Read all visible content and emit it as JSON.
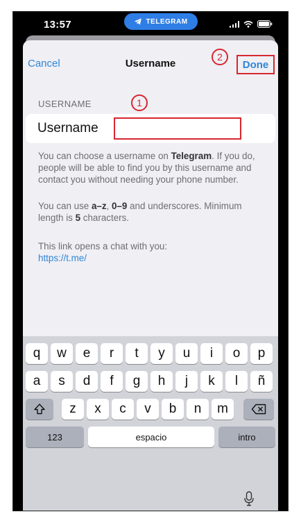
{
  "status_bar": {
    "time": "13:57",
    "app_pill": "TELEGRAM"
  },
  "nav": {
    "cancel": "Cancel",
    "title": "Username",
    "done": "Done"
  },
  "annotations": {
    "one": "1",
    "two": "2"
  },
  "form": {
    "section_header": "USERNAME",
    "field_label": "Username",
    "field_value": ""
  },
  "help": {
    "p1_a": "You can choose a username on ",
    "p1_b": "Telegram",
    "p1_c": ". If you do, people will be able to find you by this username and contact you without needing your phone number.",
    "p2_a": "You can use ",
    "p2_b": "a–z",
    "p2_c": ", ",
    "p2_d": "0–9",
    "p2_e": " and underscores. Minimum length is ",
    "p2_f": "5",
    "p2_g": " characters.",
    "p3_text": "This link opens a chat with you:",
    "p3_link": "https://t.me/"
  },
  "keyboard": {
    "row1": [
      "q",
      "w",
      "e",
      "r",
      "t",
      "y",
      "u",
      "i",
      "o",
      "p"
    ],
    "row2": [
      "a",
      "s",
      "d",
      "f",
      "g",
      "h",
      "j",
      "k",
      "l",
      "ñ"
    ],
    "row3": [
      "z",
      "x",
      "c",
      "v",
      "b",
      "n",
      "m"
    ],
    "numbers_key": "123",
    "space_key": "espacio",
    "return_key": "intro",
    "shift_icon": "shift-icon",
    "delete_icon": "backspace-icon",
    "mic_icon": "microphone-icon"
  },
  "colors": {
    "accent": "#2f86d7",
    "annotation_red": "#d7262f",
    "pill_blue": "#2f7ee6"
  }
}
